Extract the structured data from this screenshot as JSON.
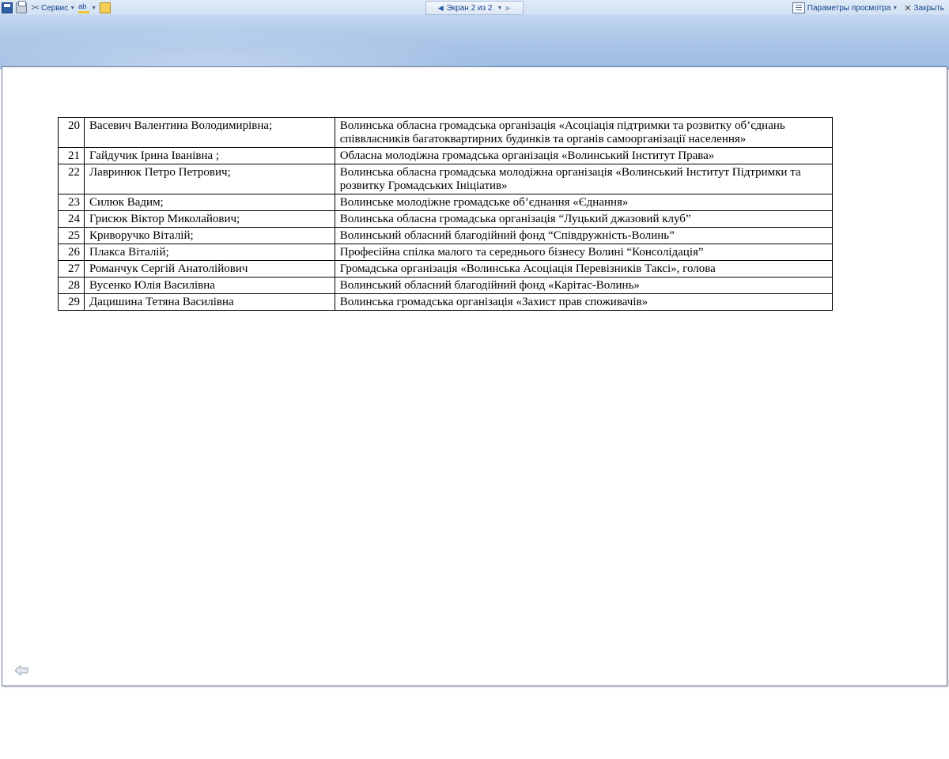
{
  "toolbar": {
    "service_label": "Сервис",
    "spell_icon_text": "ab",
    "nav_label": "Экран 2 из 2",
    "view_options_label": "Параметры просмотра",
    "close_label": "Закрыть"
  },
  "table": {
    "rows": [
      {
        "num": "20",
        "name": "Васевич Валентина Володимирівна;",
        "org": "Волинська обласна громадська організація «Асоціація підтримки та розвитку об’єднань співвласників багатоквартирних будинків та органів самоорганізації населення»"
      },
      {
        "num": "21",
        "name": "Гайдучик Ірина Іванівна ;",
        "org": "Обласна молодіжна громадська організація «Волинський Інститут Права»"
      },
      {
        "num": "22",
        "name": "Лавринюк Петро Петрович;",
        "org": "Волинська обласна громадська молодіжна організація «Волинський Інститут Підтримки та розвитку Громадських Ініціатив»"
      },
      {
        "num": "23",
        "name": "Силюк Вадим;",
        "org": "Волинське молодіжне громадське об’єднання  «Єднання»"
      },
      {
        "num": "24",
        "name": "Грисюк Віктор Миколайович;",
        "org": "Волинська обласна громадська організація “Луцький джазовий клуб”"
      },
      {
        "num": "25",
        "name": "Криворучко Віталій;",
        "org": "Волинський обласний благодійний фонд “Співдружність-Волинь”"
      },
      {
        "num": "26",
        "name": "Плакса Віталій;",
        "org": "Професійна спілка малого та середнього бізнесу Волині “Консолідація”"
      },
      {
        "num": "27",
        "name": "Романчук Сергій Анатолійович",
        "org": "Громадська організація «Волинська Асоціація Перевізників Таксі», голова"
      },
      {
        "num": "28",
        "name": "Вусенко Юлія Василівна",
        "org": "Волинський обласний благодійний фонд «Карітас-Волинь»"
      },
      {
        "num": "29",
        "name": "Дацишина Тетяна Василівна",
        "org": "Волинська громадська організація «Захист прав споживачів»"
      }
    ]
  },
  "icons": [
    "save-icon",
    "print-icon",
    "tools-icon",
    "spelling-icon",
    "folder-icon",
    "previous-screen-icon",
    "next-screen-icon",
    "view-options-icon",
    "close-icon",
    "back-arrow-icon"
  ]
}
